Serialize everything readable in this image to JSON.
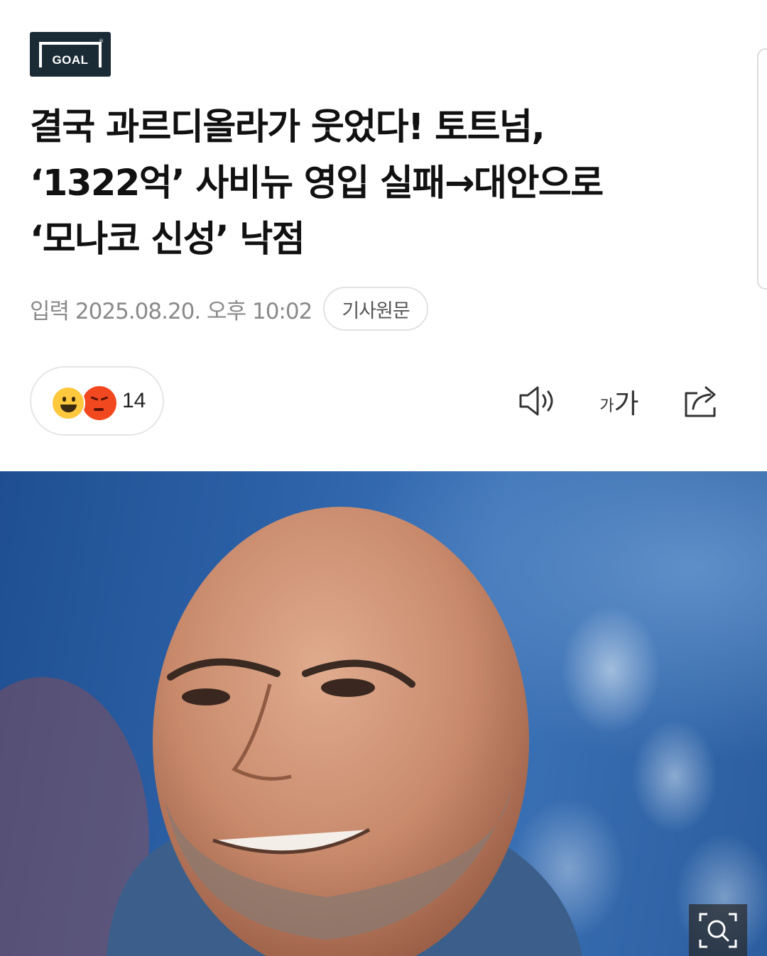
{
  "logo": {
    "text": "GOAL",
    "mark": "®"
  },
  "headline": {
    "lines": [
      "결국 과르디올라가 웃었다! 토트넘,",
      "‘1322억’ 사비뉴 영입 실패→대안으로",
      "‘모나코 신성’ 낙점"
    ]
  },
  "meta": {
    "date": "입력 2025.08.20. 오후 10:02",
    "source_button": "기사원문"
  },
  "reactions": {
    "count": "14",
    "emojis": [
      "happy-emoji",
      "angry-emoji"
    ]
  },
  "toolbar": {
    "icons": [
      "speaker-icon",
      "font-size-icon",
      "share-icon"
    ],
    "font_small": "가",
    "font_large": "가"
  },
  "photo": {
    "icon": "zoom-icon"
  },
  "colors": {
    "logo_bg": "#1b2b36",
    "meta_text": "#8a8a8a",
    "headline": "#111111"
  }
}
